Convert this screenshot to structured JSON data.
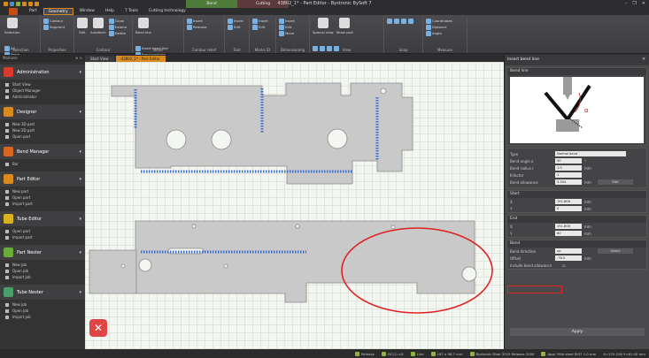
{
  "window": {
    "title": "43802_1* - Part Editor - Bystronic BySoft 7",
    "contextual_tabs": [
      "Bend",
      "Cutting"
    ],
    "contextual_subtabs": [
      "",
      "Cutting technology"
    ]
  },
  "menubar": {
    "items": [
      "Part",
      "Geometry",
      "Window",
      "Help",
      "7 Tools",
      "Cutting technology"
    ],
    "active": "Geometry"
  },
  "ribbon": {
    "groups": [
      {
        "label": "Selection",
        "buttons": [
          "Selection",
          "All",
          "None",
          "Invert"
        ]
      },
      {
        "label": "Properties",
        "buttons": [
          "Contour",
          "Segment"
        ]
      },
      {
        "label": "Contour",
        "buttons": [
          "Edit",
          "Autoform",
          "Close",
          "Extend",
          "Delete"
        ]
      },
      {
        "label": "Bend",
        "buttons": [
          "Bend line",
          "Insert bend line",
          "Bend marking"
        ]
      },
      {
        "label": "Contour relief",
        "buttons": [
          "Insert",
          "Remove"
        ]
      },
      {
        "label": "Text",
        "buttons": [
          "Insert",
          "Edit"
        ]
      },
      {
        "label": "Marks ID",
        "buttons": [
          "Insert",
          "Edit"
        ]
      },
      {
        "label": "Dimensioning",
        "buttons": [
          "Insert",
          "Edit",
          "Move"
        ]
      },
      {
        "label": "View",
        "buttons": [
          "Special view",
          "Show part"
        ]
      },
      {
        "label": "Snap",
        "buttons": []
      },
      {
        "label": "Measure",
        "buttons": [
          "Coordinates",
          "Distance",
          "Angle"
        ]
      }
    ]
  },
  "document_tabs": [
    {
      "label": "Start View",
      "active": false
    },
    {
      "label": "43802_1* - Part Editor",
      "active": true
    }
  ],
  "sidebar": {
    "header": "Modules",
    "sections": [
      {
        "title": "Administration",
        "color": "#d93a2b",
        "items": [
          "Start View",
          "Object Manager",
          "Administrator"
        ]
      },
      {
        "title": "Designer",
        "color": "#d98a1e",
        "items": [
          "New 3D part",
          "New 2D part",
          "Open part"
        ]
      },
      {
        "title": "Bend Manager",
        "color": "#d9651e",
        "items": [
          "Bar"
        ]
      },
      {
        "title": "Part Editor",
        "color": "#d98a1e",
        "items": [
          "New part",
          "Open part",
          "Import part"
        ]
      },
      {
        "title": "Tube Editor",
        "color": "#d9b31e",
        "items": [
          "Open part",
          "Import part"
        ]
      },
      {
        "title": "Part Nester",
        "color": "#6aab3a",
        "items": [
          "New job",
          "Open job",
          "Import job"
        ]
      },
      {
        "title": "Tube Nester",
        "color": "#4a9e6a",
        "items": [
          "New job",
          "Open job",
          "Import job"
        ]
      }
    ]
  },
  "panel": {
    "title": "Insert bend line",
    "sections": {
      "bend_line": "Bend line",
      "start": "Start",
      "end": "End",
      "bend": "Bend"
    },
    "fields": {
      "type": {
        "label": "Type",
        "value": "Normal bend"
      },
      "bend_angle": {
        "label": "Bend angle α",
        "value": "90",
        "unit": "°"
      },
      "bend_radius": {
        "label": "Bend radius r",
        "value": "1.5",
        "unit": "mm"
      },
      "k_factor": {
        "label": "K-factor",
        "value": "1"
      },
      "bend_allowance": {
        "label": "Bend allowance",
        "value": "3.354",
        "unit": "mm",
        "button": "Edit"
      },
      "start_x": {
        "label": "X",
        "value": "191.806",
        "unit": "mm"
      },
      "start_y": {
        "label": "Y",
        "value": "0",
        "unit": "mm"
      },
      "end_x": {
        "label": "X",
        "value": "191.806",
        "unit": "mm"
      },
      "end_y": {
        "label": "Y",
        "value": "60",
        "unit": "mm"
      },
      "bend_direction": {
        "label": "Bend direction",
        "value": "up"
      },
      "offset": {
        "label": "Offset",
        "value": "-76.5",
        "unit": "mm"
      },
      "include_allowance": {
        "label": "Include bend allowance",
        "checked": true
      },
      "select_button": "Select"
    },
    "apply_label": "Apply"
  },
  "statusbar": {
    "items": [
      "Release",
      "DC(1) v.8",
      "Linn",
      "187 x 96.7 mm",
      "Bystronic Fiber 3015 Release 2000",
      "Appl. Mild steel St37 1.0 mm",
      "X=170.228 Y=61.00 mm"
    ]
  }
}
